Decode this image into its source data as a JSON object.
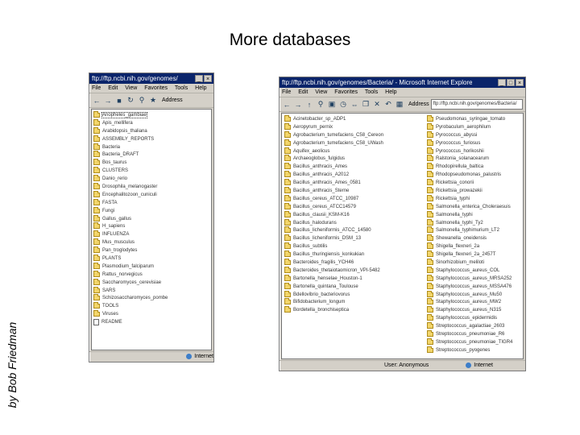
{
  "slide": {
    "title": "More databases",
    "byline": "by Bob Friedman"
  },
  "left_window": {
    "title": "ftp://ftp.ncbi.nih.gov/genomes/",
    "title_buttons": [
      "_",
      "□",
      "×"
    ],
    "menu": [
      "File",
      "Edit",
      "View",
      "Favorites",
      "Tools",
      "Help"
    ],
    "toolbar_icons": [
      "back-icon",
      "forward-icon",
      "stop-icon",
      "refresh-icon",
      "home-icon",
      "search-icon",
      "favorites-icon",
      "history-icon"
    ],
    "address_label": "Address",
    "address_value": "",
    "items": [
      {
        "name": "Anopheles_gambiae",
        "kind": "folder",
        "selected": true
      },
      {
        "name": "Apis_mellifera",
        "kind": "folder"
      },
      {
        "name": "Arabidopsis_thaliana",
        "kind": "folder"
      },
      {
        "name": "ASSEMBLY_REPORTS",
        "kind": "folder"
      },
      {
        "name": "Bacteria",
        "kind": "folder"
      },
      {
        "name": "Bacteria_DRAFT",
        "kind": "folder"
      },
      {
        "name": "Bos_taurus",
        "kind": "folder"
      },
      {
        "name": "CLUSTERS",
        "kind": "folder"
      },
      {
        "name": "Danio_rerio",
        "kind": "folder"
      },
      {
        "name": "Drosophila_melanogaster",
        "kind": "folder"
      },
      {
        "name": "Encephalitozoon_cuniculi",
        "kind": "folder"
      },
      {
        "name": "FASTA",
        "kind": "folder"
      },
      {
        "name": "Fungi",
        "kind": "folder"
      },
      {
        "name": "Gallus_gallus",
        "kind": "folder"
      },
      {
        "name": "H_sapiens",
        "kind": "folder"
      },
      {
        "name": "INFLUENZA",
        "kind": "folder"
      },
      {
        "name": "Mus_musculus",
        "kind": "folder"
      },
      {
        "name": "Pan_troglodytes",
        "kind": "folder"
      },
      {
        "name": "PLANTS",
        "kind": "folder"
      },
      {
        "name": "Plasmodium_falciparum",
        "kind": "folder"
      },
      {
        "name": "Rattus_norvegicus",
        "kind": "folder"
      },
      {
        "name": "Saccharomyces_cerevisiae",
        "kind": "folder"
      },
      {
        "name": "SARS",
        "kind": "folder"
      },
      {
        "name": "Schizosaccharomyces_pombe",
        "kind": "folder"
      },
      {
        "name": "TOOLS",
        "kind": "folder"
      },
      {
        "name": "Viruses",
        "kind": "folder"
      },
      {
        "name": "README",
        "kind": "file"
      }
    ],
    "status_left": "",
    "status_zone": "Internet"
  },
  "right_window": {
    "title": "ftp://ftp.ncbi.nih.gov/genomes/Bacteria/ - Microsoft Internet Explorer",
    "title_buttons": [
      "_",
      "□",
      "×"
    ],
    "menu": [
      "File",
      "Edit",
      "View",
      "Favorites",
      "Tools",
      "Help"
    ],
    "toolbar_icons": [
      "back-icon",
      "forward-icon",
      "up-icon",
      "search-icon",
      "folders-icon",
      "history-icon",
      "move-icon",
      "copy-icon",
      "delete-icon",
      "undo-icon",
      "views-icon"
    ],
    "address_label": "Address",
    "address_value": "ftp://ftp.ncbi.nih.gov/genomes/Bacteria/",
    "column_1": [
      "Acinetobacter_sp_ADP1",
      "Aeropyrum_pernix",
      "Agrobacterium_tumefaciens_C58_Cereon",
      "Agrobacterium_tumefaciens_C58_UWash",
      "Aquifex_aeolicus",
      "Archaeoglobus_fulgidus",
      "Bacillus_anthracis_Ames",
      "Bacillus_anthracis_A2012",
      "Bacillus_anthracis_Ames_0581",
      "Bacillus_anthracis_Sterne",
      "Bacillus_cereus_ATCC_10987",
      "Bacillus_cereus_ATCC14579",
      "Bacillus_clausii_KSM-K16",
      "Bacillus_halodurans",
      "Bacillus_licheniformis_ATCC_14580",
      "Bacillus_licheniformis_DSM_13",
      "Bacillus_subtilis",
      "Bacillus_thuringiensis_konkukian",
      "Bacteroides_fragilis_YCH46",
      "Bacteroides_thetaiotaomicron_VPI-5482",
      "Bartonella_henselae_Houston-1",
      "Bartonella_quintana_Toulouse",
      "Bdellovibrio_bacteriovorus",
      "Bifidobacterium_longum",
      "Bordetella_bronchiseptica"
    ],
    "column_2": [
      "Pseudomonas_syringae_tomato",
      "Pyrobaculum_aerophilum",
      "Pyrococcus_abyssi",
      "Pyrococcus_furiosus",
      "Pyrococcus_horikoshii",
      "Ralstonia_solanacearum",
      "Rhodopirellula_baltica",
      "Rhodopseudomonas_palustris",
      "Rickettsia_conorii",
      "Rickettsia_prowazekii",
      "Rickettsia_typhi",
      "Salmonella_enterica_Choleraesuis",
      "Salmonella_typhi",
      "Salmonella_typhi_Ty2",
      "Salmonella_typhimurium_LT2",
      "Shewanella_oneidensis",
      "Shigella_flexneri_2a",
      "Shigella_flexneri_2a_2457T",
      "Sinorhizobium_meliloti",
      "Staphylococcus_aureus_COL",
      "Staphylococcus_aureus_MRSA252",
      "Staphylococcus_aureus_MSSA476",
      "Staphylococcus_aureus_Mu50",
      "Staphylococcus_aureus_MW2",
      "Staphylococcus_aureus_N315",
      "Staphylococcus_epidermidis",
      "Streptococcus_agalactiae_2603",
      "Streptococcus_pneumoniae_R6",
      "Streptococcus_pneumoniae_TIGR4",
      "Streptococcus_pyogenes"
    ],
    "status_left": "User: Anonymous",
    "status_zone": "Internet"
  }
}
